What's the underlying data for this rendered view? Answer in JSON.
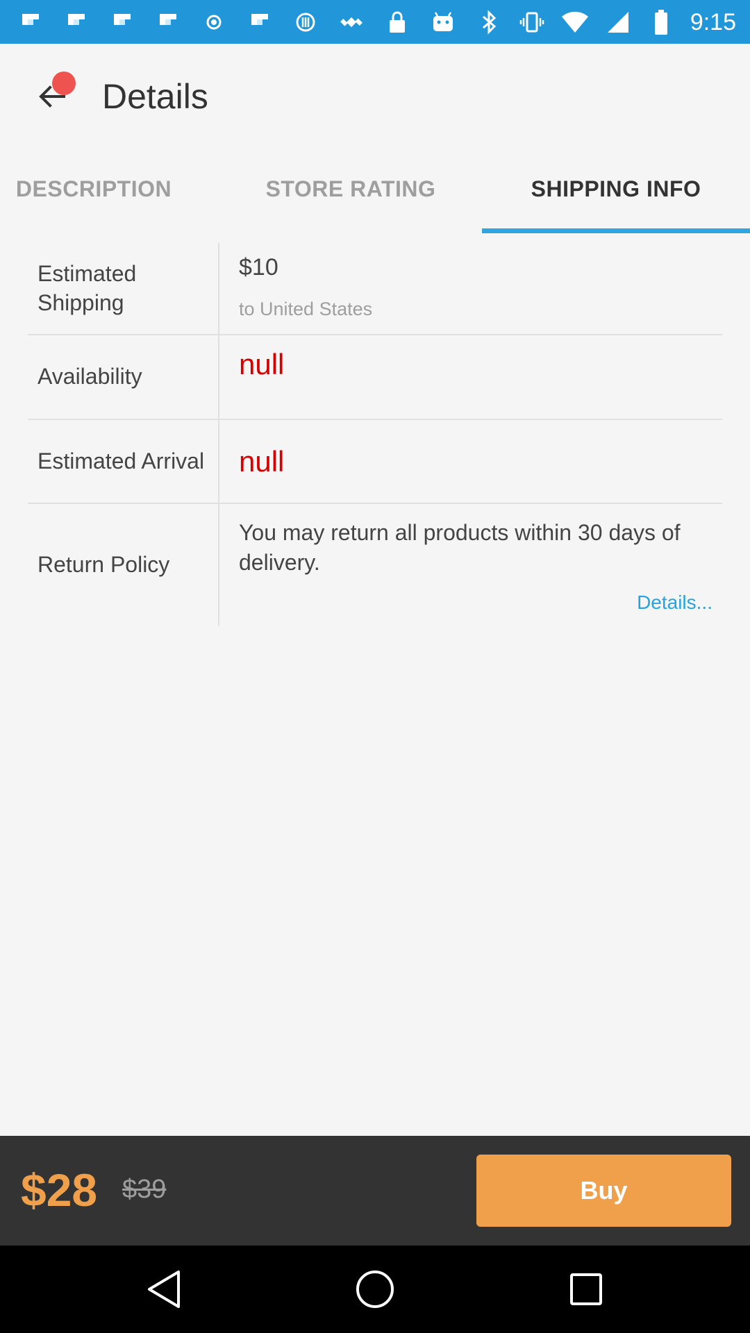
{
  "status_bar": {
    "time": "9:15",
    "left_icons": [
      "flipboard-icon",
      "flipboard-icon",
      "flipboard-icon",
      "flipboard-icon",
      "dot-icon",
      "flipboard-icon",
      "flipboard-icon",
      "satellite-icon",
      "lock-icon",
      "android-icon"
    ],
    "right_icons": [
      "bluetooth-icon",
      "vibrate-icon",
      "wifi-icon",
      "signal-icon",
      "battery-icon"
    ]
  },
  "header": {
    "title": "Details"
  },
  "tabs": [
    {
      "label": "DESCRIPTION",
      "active": false
    },
    {
      "label": "STORE RATING",
      "active": false
    },
    {
      "label": "SHIPPING INFO",
      "active": true
    }
  ],
  "shipping_info": {
    "estimated_shipping": {
      "label": "Estimated Shipping",
      "price": "$10",
      "destination": "to United States"
    },
    "availability": {
      "label": "Availability",
      "value": "null"
    },
    "estimated_arrival": {
      "label": "Estimated Arrival",
      "value": "null"
    },
    "return_policy": {
      "label": "Return Policy",
      "text": "You may return all products within 30 days of delivery.",
      "link": "Details..."
    }
  },
  "purchase": {
    "price": "$28",
    "original_price": "$39",
    "buy_label": "Buy"
  },
  "colors": {
    "status_bar": "#2196d8",
    "tab_indicator": "#2fa6e0",
    "null_text": "#d50000",
    "accent_orange": "#f0a04b",
    "link": "#29a3e0",
    "bottom_bar": "#333333"
  }
}
